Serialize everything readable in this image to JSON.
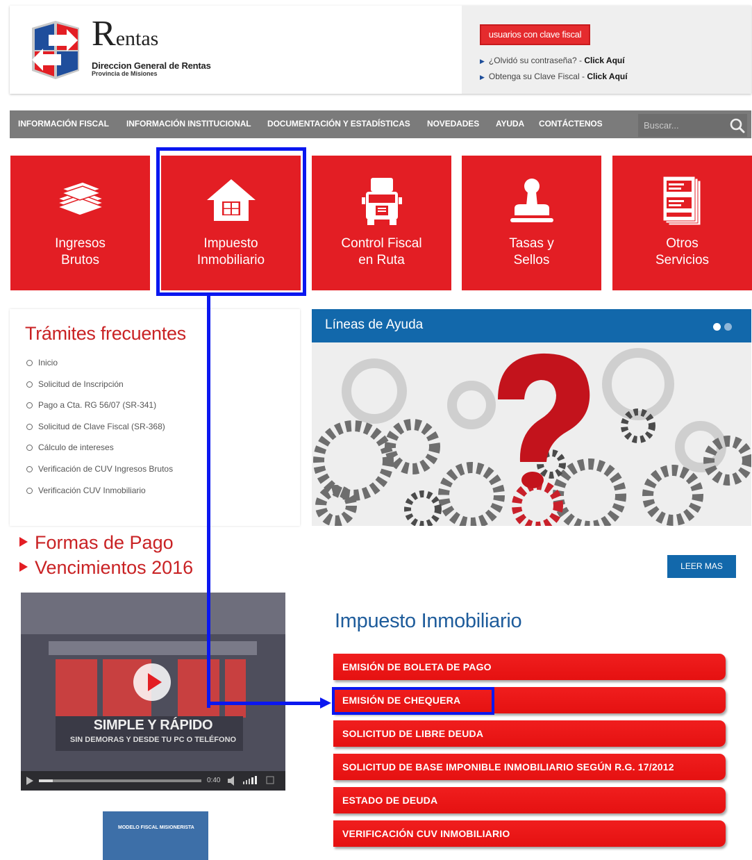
{
  "header": {
    "logo_letter": "R",
    "logo_rest": "entas",
    "org_name": "Direccion General de Rentas",
    "org_province": "Provincia de Misiones",
    "login_button": "usuarios con clave fiscal",
    "forgot_text": "¿Olvidó su contraseña? -",
    "forgot_link": "Click Aquí",
    "obtain_text": "Obtenga su Clave Fiscal -",
    "obtain_link": "Click Aquí"
  },
  "nav": {
    "items": [
      "INFORMACIÓN FISCAL",
      "INFORMACIÓN INSTITUCIONAL",
      "DOCUMENTACIÓN Y ESTADÍSTICAS",
      "NOVEDADES",
      "AYUDA",
      "CONTÁCTENOS"
    ],
    "search_placeholder": "Buscar..."
  },
  "tiles": [
    {
      "label": "Ingresos Brutos",
      "icon": "money-stack-icon"
    },
    {
      "label": "Impuesto Inmobiliario",
      "icon": "house-icon"
    },
    {
      "label": "Control Fiscal en Ruta",
      "icon": "truck-icon"
    },
    {
      "label": "Tasas y Sellos",
      "icon": "stamp-icon"
    },
    {
      "label": "Otros Servicios",
      "icon": "documents-icon"
    }
  ],
  "tramites": {
    "title": "Trámites frecuentes",
    "items": [
      "Inicio",
      "Solicitud de Inscripción",
      "Pago a Cta. RG 56/07 (SR-341)",
      "Solicitud de Clave Fiscal (SR-368)",
      "Cálculo de intereses",
      "Verificación de CUV Ingresos Brutos",
      "Verificación CUV Inmobiliario"
    ]
  },
  "lineas": {
    "title": "Líneas de Ayuda"
  },
  "promo": {
    "formas": "Formas de Pago",
    "vencimientos": "Vencimientos 2016",
    "video_caption_1": "SIMPLE Y RÁPIDO",
    "video_caption_2": "SIN DEMORAS Y DESDE TU PC O TELÉFONO",
    "video_time": "0:40",
    "book_title": "MODELO FISCAL MISIONERISTA"
  },
  "inmobiliario": {
    "leer_mas": "LEER MAS",
    "title": "Impuesto Inmobiliario",
    "actions": [
      "EMISIÓN DE BOLETA DE PAGO",
      "EMISIÓN DE CHEQUERA",
      "SOLICITUD DE LIBRE DEUDA",
      "SOLICITUD DE BASE IMPONIBLE INMOBILIARIO SEGÚN R.G. 17/2012",
      "ESTADO DE DEUDA",
      "VERIFICACIÓN CUV INMOBILIARIO"
    ]
  },
  "colors": {
    "brand_red": "#e31e24",
    "nav_gray": "#7b7b7b",
    "blue_accent": "#1268ab",
    "highlight": "#0a17f0"
  }
}
